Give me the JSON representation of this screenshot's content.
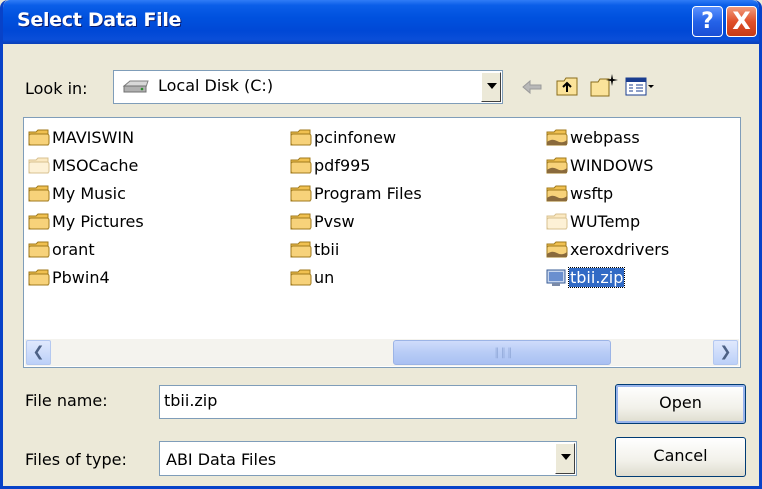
{
  "window": {
    "title": "Select Data File"
  },
  "titlebar": {
    "help_label": "?",
    "close_label": "X"
  },
  "toolbar": {
    "look_in_label": "Look in:",
    "look_in_value": "Local Disk (C:)",
    "back_icon": "back-arrow-icon",
    "up_icon": "up-folder-icon",
    "new_folder_icon": "new-folder-icon",
    "view_icon": "view-menu-icon"
  },
  "files": {
    "col1": [
      {
        "name": "MAVISWIN",
        "type": "folder"
      },
      {
        "name": "MSOCache",
        "type": "folder-hidden"
      },
      {
        "name": "My Music",
        "type": "folder"
      },
      {
        "name": "My Pictures",
        "type": "folder"
      },
      {
        "name": "orant",
        "type": "folder"
      },
      {
        "name": "Pbwin4",
        "type": "folder"
      }
    ],
    "col2": [
      {
        "name": "pcinfonew",
        "type": "folder"
      },
      {
        "name": "pdf995",
        "type": "folder"
      },
      {
        "name": "Program Files",
        "type": "folder"
      },
      {
        "name": "Pvsw",
        "type": "folder"
      },
      {
        "name": "tbii",
        "type": "folder"
      },
      {
        "name": "un",
        "type": "folder"
      }
    ],
    "col3": [
      {
        "name": "webpass",
        "type": "folder-shared"
      },
      {
        "name": "WINDOWS",
        "type": "folder-shared"
      },
      {
        "name": "wsftp",
        "type": "folder-shared"
      },
      {
        "name": "WUTemp",
        "type": "folder-hidden"
      },
      {
        "name": "xeroxdrivers",
        "type": "folder-shared"
      },
      {
        "name": "tbii.zip",
        "type": "file",
        "selected": true
      }
    ]
  },
  "form": {
    "file_name_label": "File name:",
    "file_name_value": "tbii.zip",
    "file_type_label": "Files of type:",
    "file_type_value": "ABI Data Files",
    "open_label": "Open",
    "cancel_label": "Cancel"
  },
  "colors": {
    "titlebar": "#0051de",
    "selection": "#316ac5",
    "folder": "#f7d27a"
  }
}
